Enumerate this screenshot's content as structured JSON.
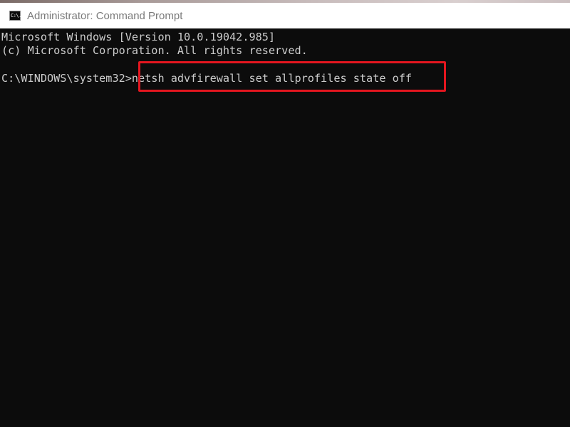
{
  "window": {
    "title": "Administrator: Command Prompt",
    "icon": "cmd-icon",
    "icon_glyph": "C:\\."
  },
  "console": {
    "lines": [
      "Microsoft Windows [Version 10.0.19042.985]",
      "(c) Microsoft Corporation. All rights reserved."
    ],
    "prompt": "C:\\WINDOWS\\system32>",
    "command": "netsh advfirewall set allprofiles state off",
    "text_color": "#cccccc",
    "background_color": "#0c0c0c"
  },
  "annotation": {
    "highlight_color": "#e4161f",
    "highlights": "command"
  }
}
